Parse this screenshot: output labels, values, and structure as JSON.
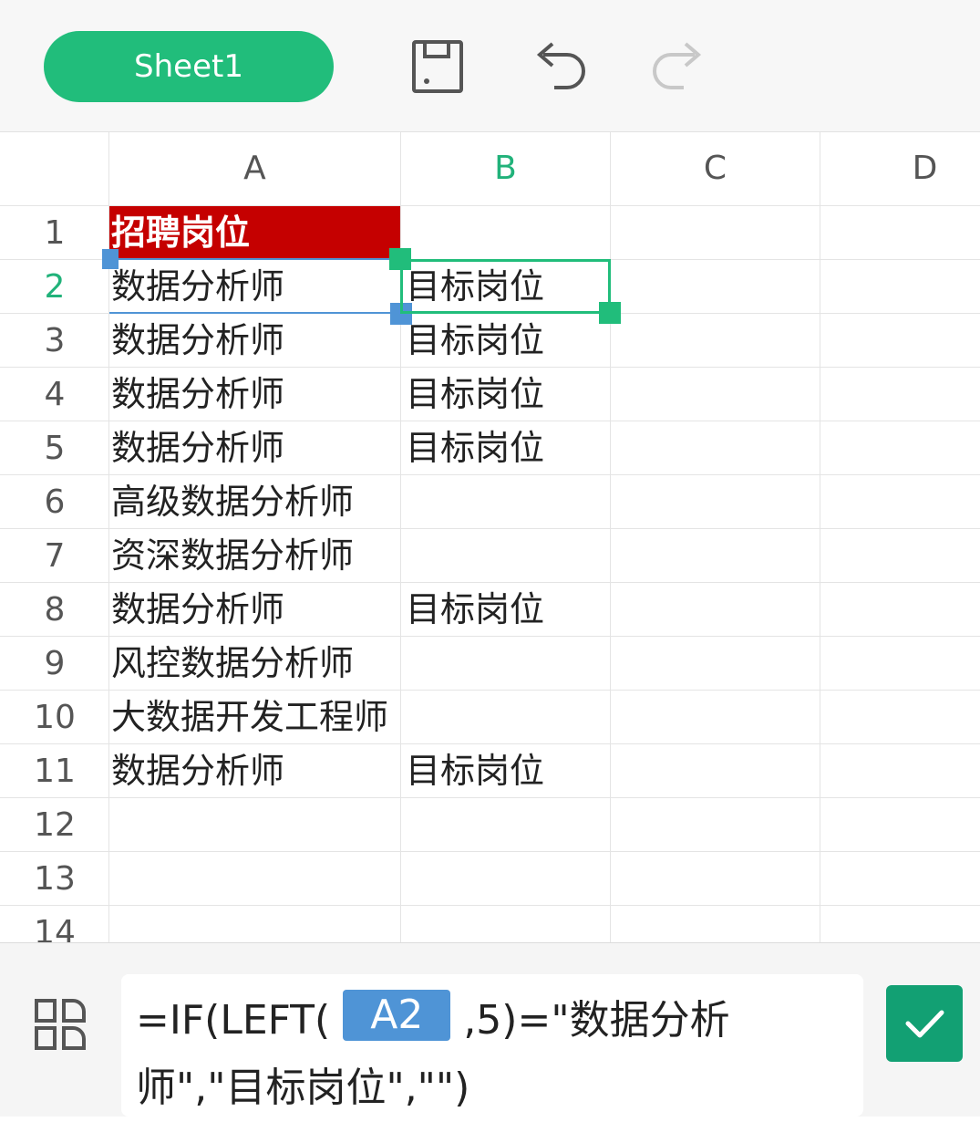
{
  "toolbar": {
    "sheet_tab_label": "Sheet1",
    "icons": [
      "save-icon",
      "undo-icon",
      "redo-icon"
    ],
    "accent": "#21bd7b"
  },
  "grid": {
    "columns": [
      "A",
      "B",
      "C",
      "D"
    ],
    "active_column": "B",
    "active_row": "2",
    "rows": [
      {
        "n": "1",
        "a": "招聘岗位",
        "b": ""
      },
      {
        "n": "2",
        "a": "数据分析师",
        "b": "目标岗位"
      },
      {
        "n": "3",
        "a": "数据分析师",
        "b": "目标岗位"
      },
      {
        "n": "4",
        "a": "数据分析师",
        "b": "目标岗位"
      },
      {
        "n": "5",
        "a": "数据分析师",
        "b": "目标岗位"
      },
      {
        "n": "6",
        "a": "高级数据分析师",
        "b": ""
      },
      {
        "n": "7",
        "a": "资深数据分析师",
        "b": ""
      },
      {
        "n": "8",
        "a": "数据分析师",
        "b": "目标岗位"
      },
      {
        "n": "9",
        "a": "风控数据分析师",
        "b": ""
      },
      {
        "n": "10",
        "a": "大数据开发工程师",
        "b": ""
      },
      {
        "n": "11",
        "a": "数据分析师",
        "b": "目标岗位"
      },
      {
        "n": "12",
        "a": "",
        "b": ""
      },
      {
        "n": "13",
        "a": "",
        "b": ""
      },
      {
        "n": "14",
        "a": "",
        "b": ""
      }
    ],
    "header_cell_color": "#c50000"
  },
  "formula": {
    "prefix": "=IF(LEFT(",
    "ref": "A2",
    "suffix_line1": ",5)=\"数据分析",
    "line2": "师\",\"目标岗位\",\"\")"
  }
}
